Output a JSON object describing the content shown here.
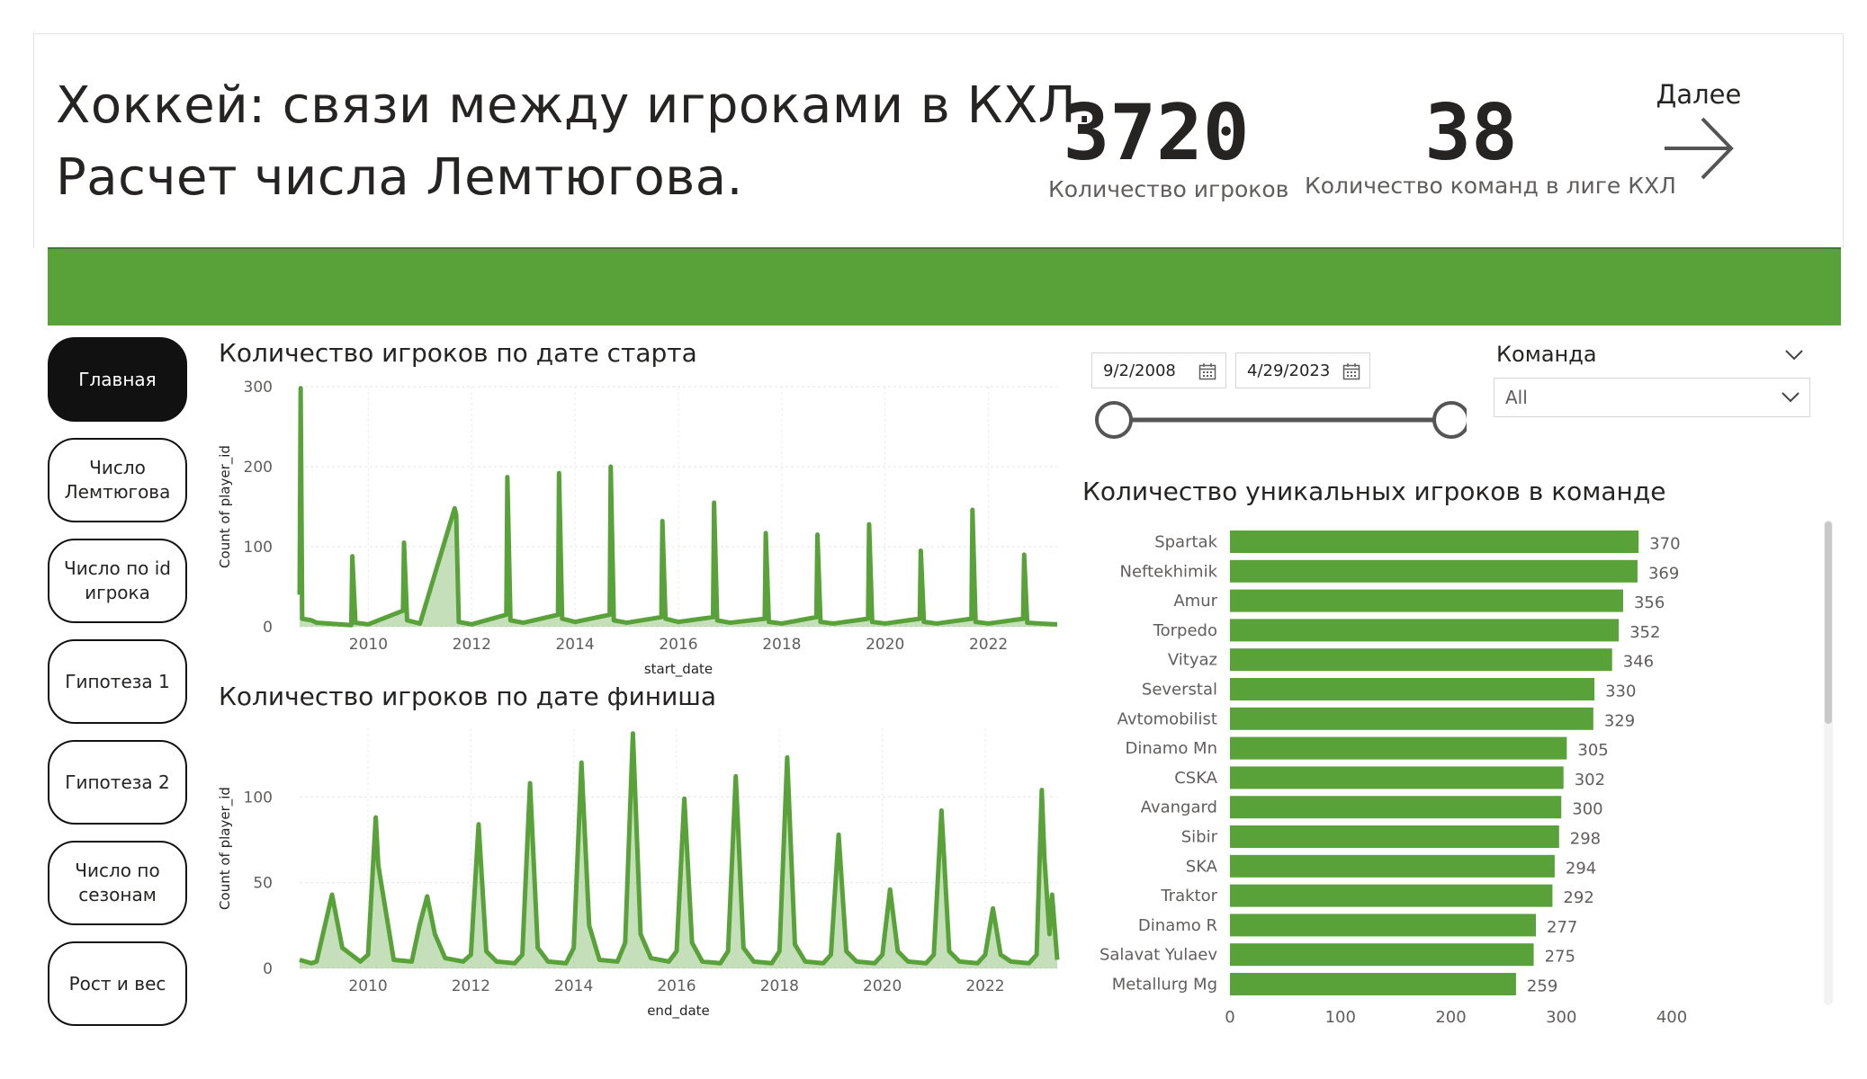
{
  "header": {
    "title_line1": "Хоккей: связи между игроками в КХЛ.",
    "title_line2": "Расчет числа Лемтюгова.",
    "kpi_players_value": "3720",
    "kpi_players_label": "Количество игроков",
    "kpi_teams_value": "38",
    "kpi_teams_label": "Количество команд в лиге КХЛ",
    "next_label": "Далее",
    "next_icon": "arrow-right-icon"
  },
  "colors": {
    "accent": "#59a23a",
    "accent_dark": "#3e7a27",
    "nav_active": "#111111"
  },
  "nav": {
    "items": [
      {
        "label": "Главная",
        "active": true
      },
      {
        "label": "Число Лемтюгова",
        "active": false
      },
      {
        "label": "Число по id игрока",
        "active": false
      },
      {
        "label": "Гипотеза 1",
        "active": false
      },
      {
        "label": "Гипотеза 2",
        "active": false
      },
      {
        "label": "Число по сезонам",
        "active": false
      },
      {
        "label": "Рост и вес",
        "active": false
      }
    ]
  },
  "filters": {
    "date_start": "9/2/2008",
    "date_end": "4/29/2023",
    "calendar_icon": "calendar-icon",
    "team_label": "Команда",
    "team_value": "All"
  },
  "chart_data": [
    {
      "type": "area",
      "title": "Количество игроков по дате старта",
      "xlabel": "start_date",
      "ylabel": "Count of player_id",
      "x_ticks": [
        "2010",
        "2012",
        "2014",
        "2016",
        "2018",
        "2020",
        "2022"
      ],
      "y_ticks": [
        "0",
        "100",
        "200",
        "300"
      ],
      "ylim": [
        0,
        300
      ],
      "xlim": [
        2008.67,
        2023.33
      ],
      "grid": true,
      "x": [
        2008.67,
        2008.69,
        2008.72,
        2008.9,
        2009.0,
        2009.67,
        2009.69,
        2009.75,
        2010.0,
        2010.67,
        2010.69,
        2010.75,
        2011.0,
        2011.67,
        2011.7,
        2011.75,
        2012.0,
        2012.67,
        2012.69,
        2012.75,
        2013.0,
        2013.67,
        2013.69,
        2013.75,
        2014.0,
        2014.67,
        2014.69,
        2014.75,
        2015.0,
        2015.67,
        2015.69,
        2015.75,
        2016.0,
        2016.67,
        2016.69,
        2016.75,
        2017.0,
        2017.67,
        2017.69,
        2017.75,
        2018.0,
        2018.67,
        2018.69,
        2018.75,
        2019.0,
        2019.67,
        2019.69,
        2019.75,
        2020.0,
        2020.67,
        2020.69,
        2020.75,
        2021.0,
        2021.67,
        2021.69,
        2021.75,
        2022.0,
        2022.67,
        2022.69,
        2022.75,
        2023.0,
        2023.33
      ],
      "values": [
        40,
        298,
        10,
        8,
        5,
        2,
        88,
        5,
        3,
        20,
        105,
        8,
        4,
        148,
        140,
        6,
        3,
        15,
        187,
        8,
        5,
        15,
        192,
        10,
        6,
        15,
        200,
        8,
        5,
        12,
        132,
        10,
        6,
        12,
        155,
        8,
        5,
        10,
        117,
        6,
        4,
        12,
        115,
        6,
        4,
        10,
        128,
        6,
        4,
        10,
        95,
        6,
        4,
        10,
        146,
        6,
        4,
        10,
        90,
        5,
        4,
        3
      ]
    },
    {
      "type": "area",
      "title": "Количество игроков по дате финиша",
      "xlabel": "end_date",
      "ylabel": "Count of player_id",
      "x_ticks": [
        "2010",
        "2012",
        "2014",
        "2016",
        "2018",
        "2020",
        "2022"
      ],
      "y_ticks": [
        "0",
        "50",
        "100"
      ],
      "ylim": [
        0,
        140
      ],
      "xlim": [
        2008.67,
        2023.4
      ],
      "grid": true,
      "x": [
        2008.67,
        2008.9,
        2009.0,
        2009.3,
        2009.5,
        2009.85,
        2010.0,
        2010.15,
        2010.2,
        2010.5,
        2010.85,
        2011.0,
        2011.15,
        2011.3,
        2011.5,
        2011.85,
        2012.0,
        2012.15,
        2012.3,
        2012.5,
        2012.85,
        2013.0,
        2013.15,
        2013.3,
        2013.5,
        2013.85,
        2014.0,
        2014.15,
        2014.3,
        2014.5,
        2014.85,
        2015.0,
        2015.15,
        2015.3,
        2015.5,
        2015.85,
        2016.0,
        2016.15,
        2016.3,
        2016.5,
        2016.85,
        2017.0,
        2017.15,
        2017.3,
        2017.5,
        2017.85,
        2018.0,
        2018.15,
        2018.3,
        2018.5,
        2018.85,
        2019.0,
        2019.15,
        2019.3,
        2019.5,
        2019.85,
        2020.0,
        2020.15,
        2020.3,
        2020.5,
        2020.85,
        2021.0,
        2021.15,
        2021.3,
        2021.5,
        2021.85,
        2022.0,
        2022.15,
        2022.3,
        2022.5,
        2022.85,
        2023.0,
        2023.1,
        2023.15,
        2023.25,
        2023.3,
        2023.4
      ],
      "values": [
        5,
        3,
        4,
        43,
        12,
        4,
        8,
        88,
        60,
        5,
        4,
        25,
        42,
        20,
        6,
        4,
        8,
        84,
        10,
        4,
        3,
        8,
        108,
        12,
        4,
        3,
        12,
        120,
        25,
        5,
        4,
        15,
        137,
        20,
        6,
        4,
        10,
        99,
        15,
        4,
        3,
        10,
        112,
        12,
        4,
        3,
        10,
        123,
        14,
        4,
        3,
        8,
        78,
        10,
        4,
        3,
        8,
        46,
        10,
        4,
        3,
        8,
        92,
        10,
        4,
        3,
        8,
        35,
        8,
        4,
        3,
        8,
        104,
        65,
        20,
        43,
        5
      ]
    },
    {
      "type": "bar",
      "orientation": "horizontal",
      "title": "Количество уникальных игроков в команде",
      "categories": [
        "Spartak",
        "Neftekhimik",
        "Amur",
        "Torpedo",
        "Vityaz",
        "Severstal",
        "Avtomobilist",
        "Dinamo Mn",
        "CSKA",
        "Avangard",
        "Sibir",
        "SKA",
        "Traktor",
        "Dinamo R",
        "Salavat Yulaev",
        "Metallurg Mg"
      ],
      "values": [
        370,
        369,
        356,
        352,
        346,
        330,
        329,
        305,
        302,
        300,
        298,
        294,
        292,
        277,
        275,
        259
      ],
      "x_ticks": [
        "0",
        "100",
        "200",
        "300",
        "400"
      ],
      "xlim": [
        0,
        400
      ]
    }
  ]
}
